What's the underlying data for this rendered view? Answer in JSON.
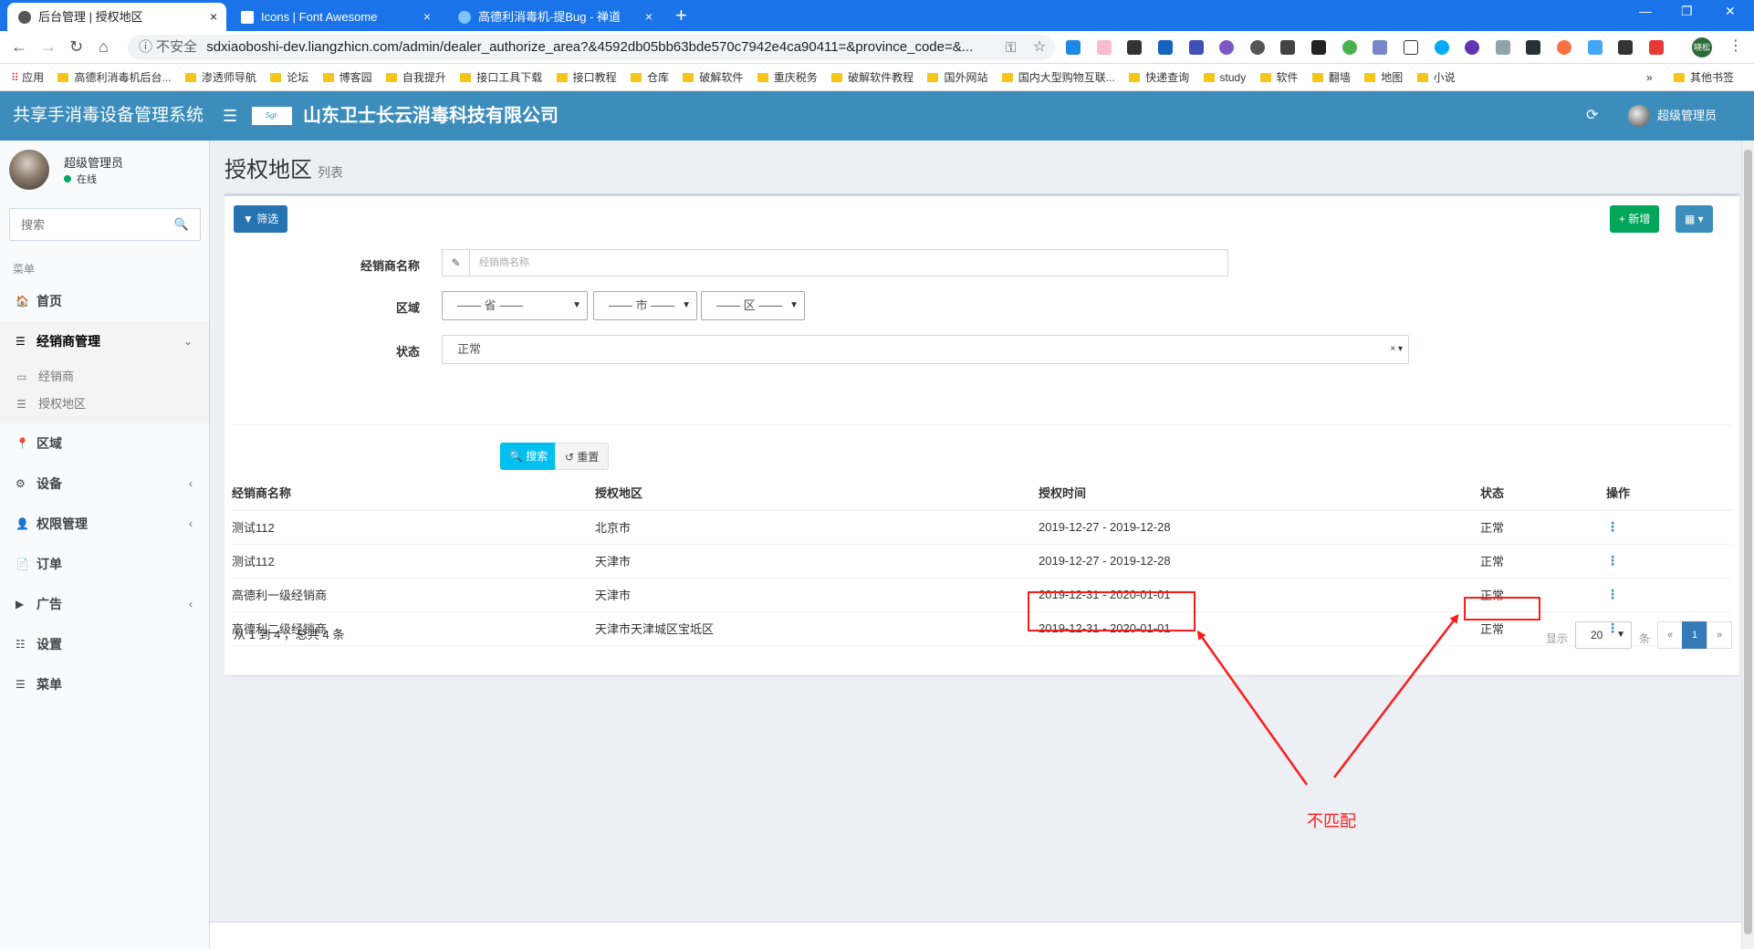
{
  "browser": {
    "tabs": [
      {
        "title": "后台管理 | 授权地区",
        "icon_color": "#3c8dbc"
      },
      {
        "title": "Icons | Font Awesome",
        "icon_color": "#1e5aa8"
      },
      {
        "title": "高德利消毒机-提Bug - 禅道",
        "icon_color": "#2b9af3"
      }
    ],
    "close_glyph": "×",
    "new_tab_glyph": "+",
    "window_controls": [
      "—",
      "❐",
      "✕"
    ],
    "insecure_label": "不安全",
    "url": "sdxiaoboshi-dev.liangzhicn.com/admin/dealer_authorize_area?&4592db05bb63bde570c7942e4ca90411=&province_code=&...",
    "profile_label": "晓松",
    "bookmarks": [
      "应用",
      "高德利消毒机后台...",
      "渗透师导航",
      "论坛",
      "博客园",
      "自我提升",
      "接口工具下载",
      "接口教程",
      "仓库",
      "破解软件",
      "重庆税务",
      "破解软件教程",
      "国外网站",
      "国内大型购物互联...",
      "快递查询",
      "study",
      "软件",
      "翻墙",
      "地图",
      "小说",
      "»",
      "其他书签"
    ]
  },
  "header": {
    "app_name": "共享手消毒设备管理系统",
    "logo_text": "Sgt-disinfect",
    "company_name": "山东卫士长云消毒科技有限公司",
    "user_name": "超级管理员"
  },
  "sidebar": {
    "user_name": "超级管理员",
    "status": "在线",
    "search_placeholder": "搜索",
    "menu_header": "菜单",
    "items": [
      {
        "icon": "🏠",
        "label": "首页"
      },
      {
        "icon": "☰",
        "label": "经销商管理",
        "chevron": "⌄"
      },
      {
        "icon": "📍",
        "label": "区域"
      },
      {
        "icon": "⚙",
        "label": "设备",
        "chevron": "‹"
      },
      {
        "icon": "👤",
        "label": "权限管理",
        "chevron": "‹"
      },
      {
        "icon": "📄",
        "label": "订单"
      },
      {
        "icon": "▶",
        "label": "广告",
        "chevron": "‹"
      },
      {
        "icon": "☷",
        "label": "设置"
      },
      {
        "icon": "☰",
        "label": "菜单"
      }
    ],
    "sub_items": [
      {
        "icon": "▭",
        "label": "经销商"
      },
      {
        "icon": "☰",
        "label": "授权地区"
      }
    ]
  },
  "page": {
    "title": "授权地区",
    "subtitle": "列表",
    "filter_button": "▼ 筛选",
    "add_button": "+ 新增",
    "columns_button": "▦ ▾"
  },
  "filters": {
    "dealer_label": "经销商名称",
    "dealer_placeholder": "经销商名称",
    "region_label": "区域",
    "province": "—— 省 ——",
    "city": "—— 市 ——",
    "district": "—— 区 ——",
    "status_label": "状态",
    "status_value": "正常",
    "clear_glyph": "× ▾",
    "search_button": "🔍 搜索",
    "reset_button": "↺ 重置"
  },
  "table": {
    "headers": [
      "经销商名称",
      "授权地区",
      "授权时间",
      "状态",
      "操作"
    ],
    "rows": [
      [
        "测试112",
        "北京市",
        "2019-12-27 - 2019-12-28",
        "正常",
        "⋮"
      ],
      [
        "测试112",
        "天津市",
        "2019-12-27 - 2019-12-28",
        "正常",
        "⋮"
      ],
      [
        "高德利一级经销商",
        "天津市",
        "2019-12-31 - 2020-01-01",
        "正常",
        "⋮"
      ],
      [
        "高德利二级经销商",
        "天津市天津城区宝坻区",
        "2019-12-31 - 2020-01-01",
        "正常",
        "⋮"
      ]
    ]
  },
  "pagination": {
    "info": "从 1 到 4 ，总共 4 条",
    "show_label": "显示",
    "page_size": "20",
    "unit": "条",
    "prev": "«",
    "current": "1",
    "next": "»"
  },
  "annotation": {
    "text": "不匹配",
    "color": "#ff1a1a"
  }
}
